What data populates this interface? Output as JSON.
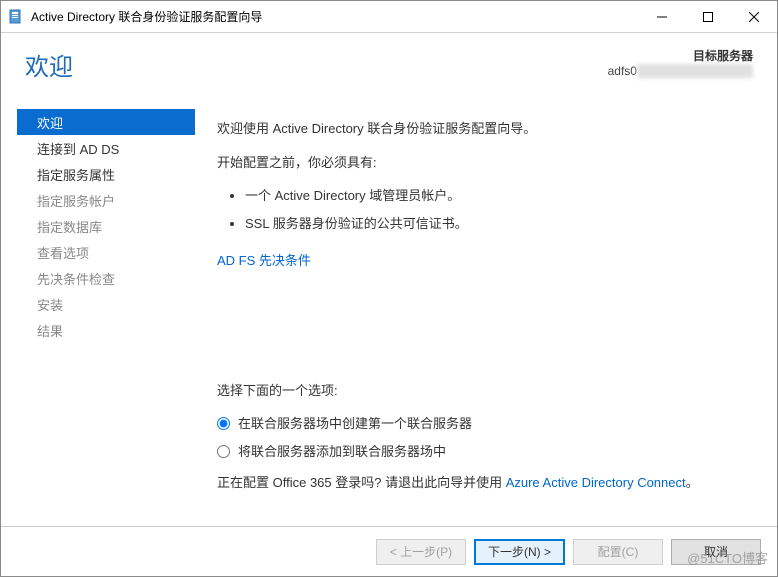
{
  "titlebar": {
    "text": "Active Directory 联合身份验证服务配置向导"
  },
  "header": {
    "page_title": "欢迎",
    "target_label": "目标服务器",
    "target_value_prefix": "adfs0"
  },
  "sidebar": {
    "items": [
      {
        "label": "欢迎",
        "active": true,
        "enabled": true
      },
      {
        "label": "连接到 AD DS",
        "active": false,
        "enabled": true
      },
      {
        "label": "指定服务属性",
        "active": false,
        "enabled": true
      },
      {
        "label": "指定服务帐户",
        "active": false,
        "enabled": false
      },
      {
        "label": "指定数据库",
        "active": false,
        "enabled": false
      },
      {
        "label": "查看选项",
        "active": false,
        "enabled": false
      },
      {
        "label": "先决条件检查",
        "active": false,
        "enabled": false
      },
      {
        "label": "安装",
        "active": false,
        "enabled": false
      },
      {
        "label": "结果",
        "active": false,
        "enabled": false
      }
    ]
  },
  "content": {
    "intro": "欢迎使用 Active Directory 联合身份验证服务配置向导。",
    "prereq_header": "开始配置之前，你必须具有:",
    "prereq_items": [
      "一个 Active Directory 域管理员帐户。",
      "SSL 服务器身份验证的公共可信证书。"
    ],
    "prereq_link": "AD FS 先决条件",
    "choose_label": "选择下面的一个选项:",
    "radios": [
      {
        "label": "在联合服务器场中创建第一个联合服务器",
        "checked": true
      },
      {
        "label": "将联合服务器添加到联合服务器场中",
        "checked": false
      }
    ],
    "o365_prefix": "正在配置 Office 365 登录吗? 请退出此向导并使用 ",
    "o365_link": "Azure Active Directory Connect",
    "o365_suffix": "。"
  },
  "buttons": {
    "prev": "< 上一步(P)",
    "next": "下一步(N) >",
    "configure": "配置(C)",
    "cancel": "取消"
  },
  "watermark": "@51CTO博客"
}
